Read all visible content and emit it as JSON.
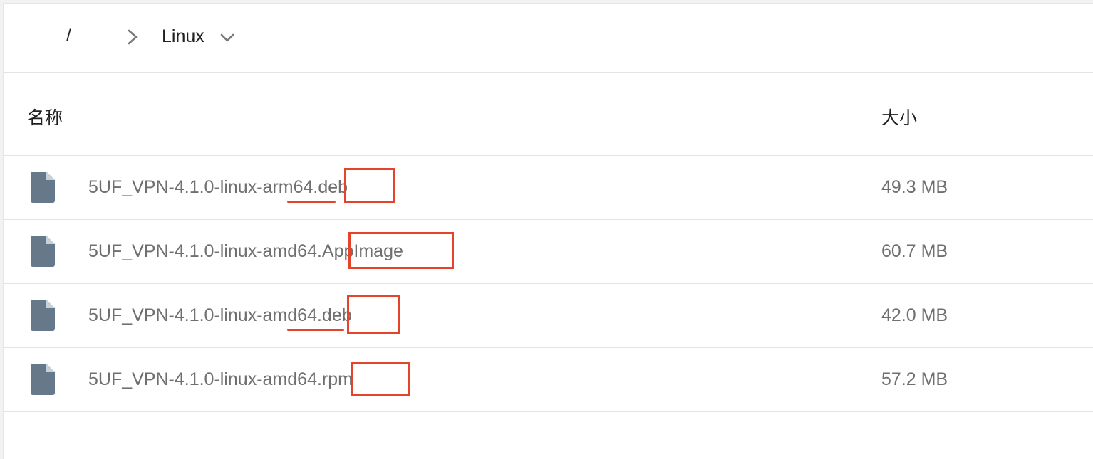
{
  "breadcrumb": {
    "root": "/",
    "current": "Linux"
  },
  "table": {
    "columns": {
      "name": "名称",
      "size": "大小"
    },
    "rows": [
      {
        "name": "5UF_VPN-4.1.0-linux-arm64.deb",
        "size": "49.3 MB",
        "icon": "file-icon"
      },
      {
        "name": "5UF_VPN-4.1.0-linux-amd64.AppImage",
        "size": "60.7 MB",
        "icon": "file-icon"
      },
      {
        "name": "5UF_VPN-4.1.0-linux-amd64.deb",
        "size": "42.0 MB",
        "icon": "file-icon"
      },
      {
        "name": "5UF_VPN-4.1.0-linux-amd64.rpm",
        "size": "57.2 MB",
        "icon": "file-icon"
      }
    ]
  },
  "colors": {
    "annotation": "#e3442b",
    "icon": "#66798a",
    "text_muted": "#6f6f6f"
  }
}
